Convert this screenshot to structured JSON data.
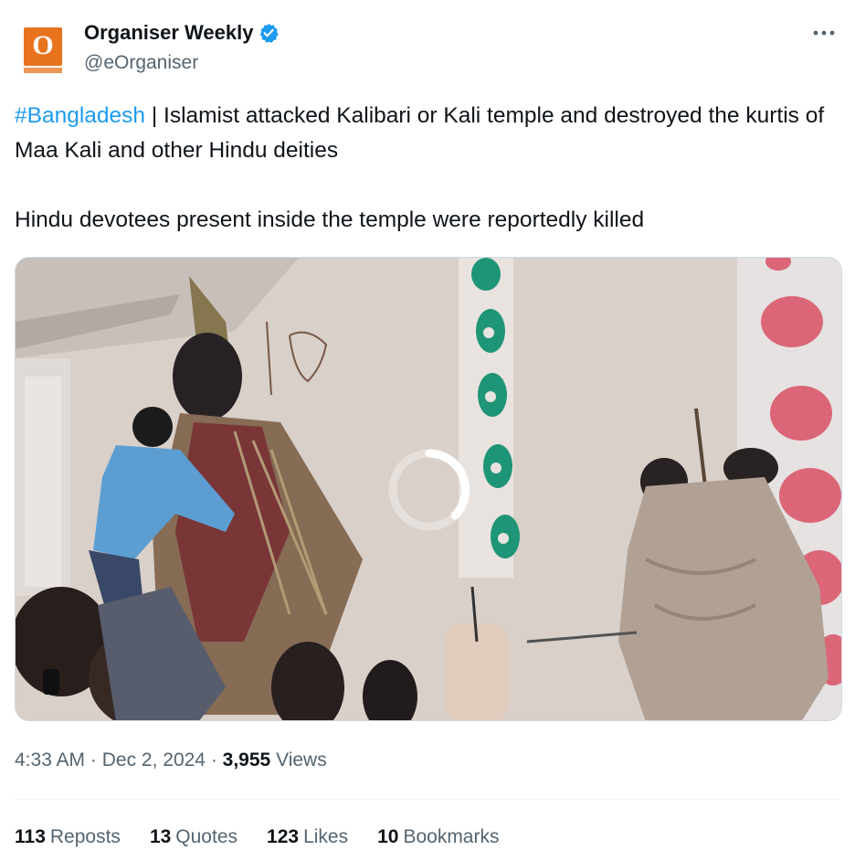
{
  "author": {
    "display_name": "Organiser Weekly",
    "handle": "@eOrganiser",
    "verified": true,
    "avatar_icon": "organiser-logo",
    "avatar_letter": "O",
    "brand_color": "#e8731e"
  },
  "tweet": {
    "hashtag": "#Bangladesh",
    "line1_rest": " | Islamist attacked Kalibari or Kali temple and destroyed the kurtis of Maa Kali and other Hindu deities",
    "line2": "Hindu devotees present inside the temple were reportedly killed"
  },
  "media": {
    "type": "video",
    "loading_icon": "spinner-icon"
  },
  "meta": {
    "time": "4:33 AM",
    "separator": " · ",
    "date": "Dec 2, 2024",
    "views_count": "3,955",
    "views_label": "Views"
  },
  "stats": [
    {
      "count": "113",
      "label": "Reposts"
    },
    {
      "count": "13",
      "label": "Quotes"
    },
    {
      "count": "123",
      "label": "Likes"
    },
    {
      "count": "10",
      "label": "Bookmarks"
    }
  ],
  "colors": {
    "link": "#1d9bf0",
    "verified_badge": "#1d9bf0",
    "secondary_text": "#536471",
    "primary_text": "#0f1419"
  }
}
